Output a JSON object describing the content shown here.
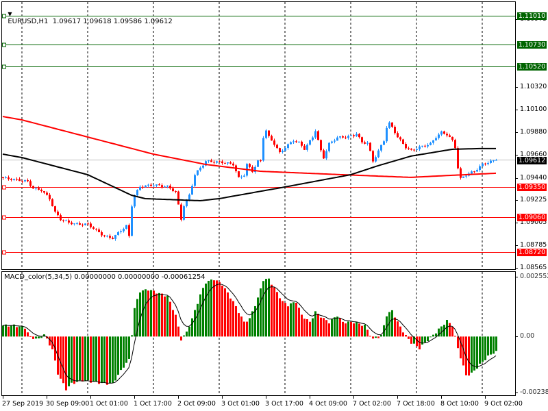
{
  "header": {
    "symbol": "EURUSD,H1",
    "ohlc": "1.09617 1.09618 1.09586 1.09612"
  },
  "macd_header": {
    "label": "MACD_color(5,34,5) 0.00000000 0.00000000 -0.00061254"
  },
  "colors": {
    "bull": "#1E90FF",
    "bear": "#FF0000",
    "ma_fast": "#000000",
    "ma_slow": "#FF0000",
    "level_green": "#006400",
    "level_red": "#FF0000",
    "hist_up": "#008000",
    "hist_down": "#FF0000"
  },
  "chart_data": [
    {
      "type": "candlestick",
      "title": "EURUSD,H1",
      "candle_count": 181,
      "ylim": [
        1.0852,
        1.1106
      ],
      "y_ticks": [
        "1.10975",
        "1.10320",
        "1.10100",
        "1.09880",
        "1.09660",
        "1.09440",
        "1.09225",
        "1.09005",
        "1.08785",
        "1.08565"
      ],
      "current_price": "1.09612",
      "green_levels": [
        "1.11010",
        "1.10730",
        "1.10520"
      ],
      "red_levels": [
        "1.09350",
        "1.09060",
        "1.08720"
      ],
      "close_waypoints": [
        [
          0,
          1.09437
        ],
        [
          5,
          1.0942
        ],
        [
          9,
          1.09404
        ],
        [
          11,
          1.09337
        ],
        [
          14,
          1.0932
        ],
        [
          17,
          1.09238
        ],
        [
          19,
          1.09105
        ],
        [
          21,
          1.09039
        ],
        [
          24,
          1.09006
        ],
        [
          27,
          1.0899
        ],
        [
          31,
          1.0899
        ],
        [
          34,
          1.0893
        ],
        [
          37,
          1.08873
        ],
        [
          40,
          1.08856
        ],
        [
          43,
          1.0893
        ],
        [
          45,
          1.08973
        ],
        [
          46,
          1.08873
        ],
        [
          47,
          1.09172
        ],
        [
          48,
          1.09271
        ],
        [
          50,
          1.09354
        ],
        [
          55,
          1.09371
        ],
        [
          60,
          1.09354
        ],
        [
          63,
          1.09304
        ],
        [
          64,
          1.09172
        ],
        [
          65,
          1.09039
        ],
        [
          66,
          1.09172
        ],
        [
          68,
          1.09271
        ],
        [
          70,
          1.0947
        ],
        [
          72,
          1.09537
        ],
        [
          74,
          1.096
        ],
        [
          80,
          1.0959
        ],
        [
          84,
          1.0957
        ],
        [
          86,
          1.09437
        ],
        [
          88,
          1.0947
        ],
        [
          89,
          1.0957
        ],
        [
          91,
          1.09503
        ],
        [
          93,
          1.096
        ],
        [
          94,
          1.09603
        ],
        [
          95,
          1.09835
        ],
        [
          96,
          1.099
        ],
        [
          97,
          1.09835
        ],
        [
          99,
          1.09769
        ],
        [
          101,
          1.0968
        ],
        [
          103,
          1.09736
        ],
        [
          106,
          1.09802
        ],
        [
          108,
          1.0978
        ],
        [
          110,
          1.0972
        ],
        [
          113,
          1.09835
        ],
        [
          114,
          1.099
        ],
        [
          116,
          1.097
        ],
        [
          117,
          1.09636
        ],
        [
          119,
          1.09769
        ],
        [
          122,
          1.0983
        ],
        [
          125,
          1.09835
        ],
        [
          128,
          1.0985
        ],
        [
          129,
          1.0987
        ],
        [
          131,
          1.0978
        ],
        [
          133,
          1.0978
        ],
        [
          135,
          1.096
        ],
        [
          137,
          1.097
        ],
        [
          139,
          1.098
        ],
        [
          140,
          1.0993
        ],
        [
          141,
          1.09968
        ],
        [
          142,
          1.0993
        ],
        [
          144,
          1.09835
        ],
        [
          147,
          1.09736
        ],
        [
          149,
          1.09703
        ],
        [
          152,
          1.09736
        ],
        [
          156,
          1.09769
        ],
        [
          158,
          1.09835
        ],
        [
          160,
          1.0988
        ],
        [
          162,
          1.0986
        ],
        [
          164,
          1.098
        ],
        [
          165,
          1.09736
        ],
        [
          166,
          1.09537
        ],
        [
          167,
          1.0943
        ],
        [
          169,
          1.0947
        ],
        [
          172,
          1.09503
        ],
        [
          175,
          1.0957
        ],
        [
          177,
          1.0959
        ],
        [
          180,
          1.09612
        ]
      ],
      "ma_fast_waypoints": [
        [
          0,
          1.09669
        ],
        [
          7,
          1.09636
        ],
        [
          31,
          1.0947
        ],
        [
          47,
          1.09271
        ],
        [
          52,
          1.09238
        ],
        [
          72,
          1.09218
        ],
        [
          79,
          1.09238
        ],
        [
          103,
          1.09351
        ],
        [
          127,
          1.0947
        ],
        [
          137,
          1.09557
        ],
        [
          149,
          1.0965
        ],
        [
          164,
          1.09716
        ],
        [
          174,
          1.09723
        ],
        [
          180,
          1.09723
        ]
      ],
      "ma_slow_waypoints": [
        [
          0,
          1.10034
        ],
        [
          7,
          1.10001
        ],
        [
          31,
          1.09835
        ],
        [
          55,
          1.09669
        ],
        [
          74,
          1.0957
        ],
        [
          94,
          1.09503
        ],
        [
          124,
          1.0947
        ],
        [
          149,
          1.09444
        ],
        [
          164,
          1.09464
        ],
        [
          180,
          1.09484
        ]
      ],
      "x_labels": [
        {
          "index": 0,
          "label": "27 Sep 2019"
        },
        {
          "index": 16,
          "label": "30 Sep 09:00"
        },
        {
          "index": 32,
          "label": "1 Oct 01:00"
        },
        {
          "index": 48,
          "label": "1 Oct 17:00"
        },
        {
          "index": 64,
          "label": "2 Oct 09:00"
        },
        {
          "index": 80,
          "label": "3 Oct 01:00"
        },
        {
          "index": 96,
          "label": "3 Oct 17:00"
        },
        {
          "index": 112,
          "label": "4 Oct 09:00"
        },
        {
          "index": 128,
          "label": "7 Oct 02:00"
        },
        {
          "index": 144,
          "label": "7 Oct 18:00"
        },
        {
          "index": 160,
          "label": "8 Oct 10:00"
        },
        {
          "index": 176,
          "label": "9 Oct 02:00"
        }
      ],
      "day_separators": [
        7,
        31,
        55,
        79,
        103,
        127,
        151,
        175
      ]
    },
    {
      "type": "bar",
      "title": "MACD_color(5,34,5)",
      "ylim": [
        -0.002387,
        0.0025528
      ],
      "y_ticks": [
        "0.0025528",
        "0.00",
        "-0.002387"
      ],
      "last_value": -0.00061254,
      "macd_waypoints": [
        [
          0,
          0.00047
        ],
        [
          4,
          0.00047
        ],
        [
          8,
          0.00038
        ],
        [
          10,
          -3e-05
        ],
        [
          13,
          -0.00012
        ],
        [
          15,
          9e-05
        ],
        [
          18,
          -0.00055
        ],
        [
          20,
          -0.00158
        ],
        [
          23,
          -0.00225
        ],
        [
          25,
          -0.00201
        ],
        [
          29,
          -0.00187
        ],
        [
          37,
          -0.00201
        ],
        [
          40,
          -0.00201
        ],
        [
          44,
          -0.00128
        ],
        [
          46,
          -0.00099
        ],
        [
          48,
          0.0012
        ],
        [
          50,
          0.00193
        ],
        [
          53,
          0.00201
        ],
        [
          57,
          0.00184
        ],
        [
          60,
          0.00172
        ],
        [
          63,
          0.00091
        ],
        [
          65,
          -0.00012
        ],
        [
          67,
          0.00018
        ],
        [
          69,
          0.00076
        ],
        [
          72,
          0.00178
        ],
        [
          74,
          0.00231
        ],
        [
          77,
          0.00245
        ],
        [
          80,
          0.00222
        ],
        [
          84,
          0.00149
        ],
        [
          88,
          0.00061
        ],
        [
          90,
          0.00076
        ],
        [
          93,
          0.00164
        ],
        [
          95,
          0.00242
        ],
        [
          97,
          0.00245
        ],
        [
          99,
          0.00207
        ],
        [
          102,
          0.00149
        ],
        [
          104,
          0.00134
        ],
        [
          107,
          0.00149
        ],
        [
          109,
          0.00091
        ],
        [
          112,
          0.00061
        ],
        [
          114,
          0.00105
        ],
        [
          117,
          0.00076
        ],
        [
          119,
          0.00061
        ],
        [
          122,
          0.0009
        ],
        [
          124,
          0.00061
        ],
        [
          128,
          0.00061
        ],
        [
          132,
          0.00047
        ],
        [
          135,
          -0.00012
        ],
        [
          138,
          3e-05
        ],
        [
          140,
          0.00091
        ],
        [
          142,
          0.00111
        ],
        [
          144,
          0.00061
        ],
        [
          147,
          3e-05
        ],
        [
          149,
          -0.00026
        ],
        [
          152,
          -0.0005
        ],
        [
          154,
          -0.00026
        ],
        [
          158,
          0.00018
        ],
        [
          162,
          0.00067
        ],
        [
          164,
          0.00047
        ],
        [
          166,
          -0.0005
        ],
        [
          169,
          -0.00166
        ],
        [
          171,
          -0.00158
        ],
        [
          174,
          -0.0012
        ],
        [
          177,
          -0.00085
        ],
        [
          180,
          -0.00061
        ]
      ]
    }
  ]
}
